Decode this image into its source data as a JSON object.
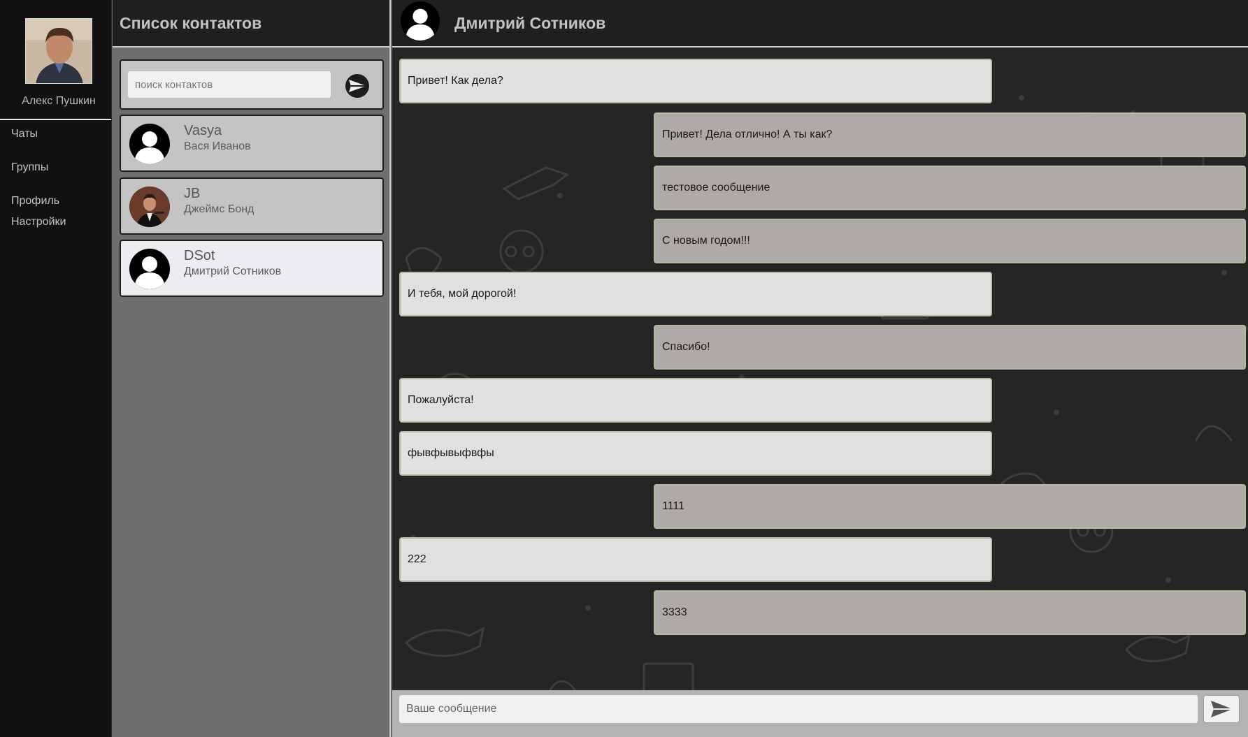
{
  "profile": {
    "name": "Алекс Пушкин"
  },
  "nav": {
    "items": [
      {
        "label": "Чаты"
      },
      {
        "label": "Группы"
      },
      {
        "label": "Профиль"
      },
      {
        "label": "Настройки"
      }
    ]
  },
  "contacts": {
    "title": "Список контактов",
    "search_placeholder": "поиск контактов",
    "items": [
      {
        "nick": "Vasya",
        "full_name": "Вася Иванов"
      },
      {
        "nick": "JB",
        "full_name": "Джеймс Бонд"
      },
      {
        "nick": "DSot",
        "full_name": "Дмитрий Сотников"
      }
    ]
  },
  "chat": {
    "title": "Дмитрий Сотников",
    "messages": [
      {
        "text": "Привет! Как дела?",
        "direction": "in"
      },
      {
        "text": "Привет! Дела отлично! А ты как?",
        "direction": "out"
      },
      {
        "text": "тестовое сообщение",
        "direction": "out"
      },
      {
        "text": "С новым годом!!!",
        "direction": "out"
      },
      {
        "text": "И тебя, мой дорогой!",
        "direction": "in"
      },
      {
        "text": "Спасибо!",
        "direction": "out"
      },
      {
        "text": "Пожалуйста!",
        "direction": "in"
      },
      {
        "text": "фывфывыфвфы",
        "direction": "in"
      },
      {
        "text": "1111",
        "direction": "out"
      },
      {
        "text": "222",
        "direction": "in"
      },
      {
        "text": "3333",
        "direction": "out"
      }
    ],
    "composer_placeholder": "Ваше сообщение"
  },
  "colors": {
    "nav_bg": "#111111",
    "header_bg": "#1f1f1f",
    "incoming_bubble": "#e0e0e0",
    "outgoing_bubble": "#aeaaa8",
    "active_contact": "#ececf1"
  },
  "icons": [
    "default-avatar-icon",
    "send-arrow-icon"
  ]
}
